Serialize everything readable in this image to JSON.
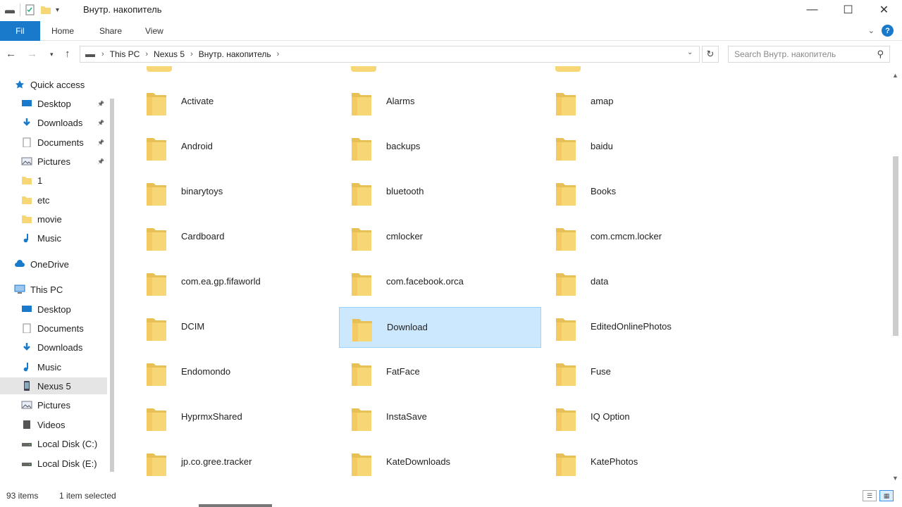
{
  "window": {
    "title": "Внутр. накопитель",
    "controls": [
      "—",
      "☐",
      "✕"
    ]
  },
  "ribbon": {
    "file_label": "Fil",
    "tabs": [
      "Home",
      "Share",
      "View"
    ],
    "help": "?"
  },
  "address": {
    "crumbs": [
      "This PC",
      "Nexus 5",
      "Внутр. накопитель"
    ],
    "search_placeholder": "Search Внутр. накопитель"
  },
  "sidebar": {
    "items": [
      {
        "label": "Quick access",
        "icon": "star-icon",
        "pinned": false,
        "level": 0
      },
      {
        "label": "Desktop",
        "icon": "desktop-icon",
        "pinned": true,
        "level": 1
      },
      {
        "label": "Downloads",
        "icon": "download-icon",
        "pinned": true,
        "level": 1
      },
      {
        "label": "Documents",
        "icon": "document-icon",
        "pinned": true,
        "level": 1
      },
      {
        "label": "Pictures",
        "icon": "picture-icon",
        "pinned": true,
        "level": 1
      },
      {
        "label": "1",
        "icon": "folder-icon",
        "pinned": false,
        "level": 1
      },
      {
        "label": "etc",
        "icon": "folder-icon",
        "pinned": false,
        "level": 1
      },
      {
        "label": "movie",
        "icon": "folder-icon",
        "pinned": false,
        "level": 1
      },
      {
        "label": "Music",
        "icon": "music-icon",
        "pinned": false,
        "level": 1
      },
      {
        "label": "OneDrive",
        "icon": "cloud-icon",
        "pinned": false,
        "level": 0
      },
      {
        "label": "This PC",
        "icon": "computer-icon",
        "pinned": false,
        "level": 0
      },
      {
        "label": "Desktop",
        "icon": "desktop-icon",
        "pinned": false,
        "level": 1
      },
      {
        "label": "Documents",
        "icon": "document-icon",
        "pinned": false,
        "level": 1
      },
      {
        "label": "Downloads",
        "icon": "download-icon",
        "pinned": false,
        "level": 1
      },
      {
        "label": "Music",
        "icon": "music-icon",
        "pinned": false,
        "level": 1
      },
      {
        "label": "Nexus 5",
        "icon": "phone-icon",
        "pinned": false,
        "level": 1,
        "selected": true
      },
      {
        "label": "Pictures",
        "icon": "picture-icon",
        "pinned": false,
        "level": 1
      },
      {
        "label": "Videos",
        "icon": "video-icon",
        "pinned": false,
        "level": 1
      },
      {
        "label": "Local Disk (C:)",
        "icon": "drive-icon",
        "pinned": false,
        "level": 1
      },
      {
        "label": "Local Disk (E:)",
        "icon": "drive-icon",
        "pinned": false,
        "level": 1
      }
    ]
  },
  "folders": [
    [
      "Activate",
      "Alarms",
      "amap"
    ],
    [
      "Android",
      "backups",
      "baidu"
    ],
    [
      "binarytoys",
      "bluetooth",
      "Books"
    ],
    [
      "Cardboard",
      "cmlocker",
      "com.cmcm.locker"
    ],
    [
      "com.ea.gp.fifaworld",
      "com.facebook.orca",
      "data"
    ],
    [
      "DCIM",
      "Download",
      "EditedOnlinePhotos"
    ],
    [
      "Endomondo",
      "FatFace",
      "Fuse"
    ],
    [
      "HyprmxShared",
      "InstaSave",
      "IQ Option"
    ],
    [
      "jp.co.gree.tracker",
      "KateDownloads",
      "KatePhotos"
    ]
  ],
  "selected_folder": "Download",
  "status": {
    "count": "93 items",
    "selection": "1 item selected"
  },
  "colors": {
    "accent": "#1979ca",
    "folder": "#f7d675",
    "selection": "#cce8ff"
  }
}
